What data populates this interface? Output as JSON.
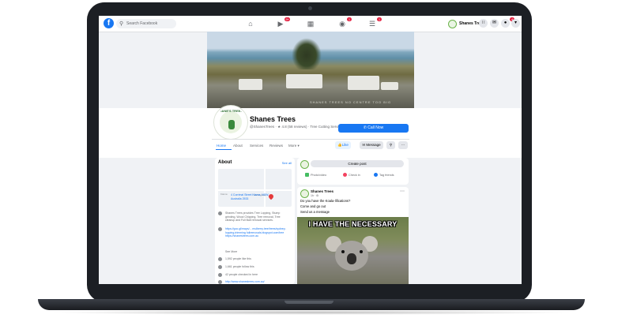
{
  "topnav": {
    "search_placeholder": "Search Facebook",
    "profile_name": "Shanes Trees",
    "badges": {
      "watch": "9+",
      "marketplace": "",
      "groups": "1",
      "gaming": "1",
      "notifications": "4"
    }
  },
  "cover": {
    "caption": "SHANES TREES NO CENTRE TOO BIG"
  },
  "logo": {
    "text": "SHANE'S TREES"
  },
  "page": {
    "name": "Shanes Trees",
    "subtitle": "@ShanesTrees · ★ 4.8 (58 reviews) · Tree Cutting Service",
    "call_button": "Call Now"
  },
  "tabs": [
    "Home",
    "About",
    "Services",
    "Reviews",
    "More ▾"
  ],
  "actions": {
    "like": "Like",
    "message": "Message"
  },
  "about": {
    "title": "About",
    "see_all": "See all",
    "address": "4 Corrimal Street Kiama, NSW, Australia 2533",
    "map_labels": [
      "Kiama",
      "Gerringong"
    ],
    "description": "Shanes Trees provides Tree Lopping, Stump grinding, Wood Chipping, Tree removal, Tree cleanup and Full Bait removal services.",
    "links": "https://goo.gl/maps/...  mulberry.tree/trees/sydney-lopping-trimming  fullremovals.blogspot.com/tree https://shanestrees.com.au",
    "see_more": "See More",
    "likes": "1,592 people like this",
    "follows": "1,661 people follow this",
    "checkins": "42 people checked in here",
    "website": "http://www.shanestrees.com.au/"
  },
  "create_post": {
    "button": "Create post",
    "options": [
      "Photo/video",
      "Check in",
      "Tag friends"
    ]
  },
  "post": {
    "author": "Shanes Trees",
    "time": "1h · ⚙",
    "lines": [
      "Do you have the Koala-lifications?",
      "Come and go out",
      "Send us a message"
    ],
    "meme_text": "I HAVE THE NECESSARY"
  },
  "colors": {
    "brand_blue": "#1877f2",
    "badge_red": "#e41e3f",
    "frame": "#1c1f24"
  }
}
